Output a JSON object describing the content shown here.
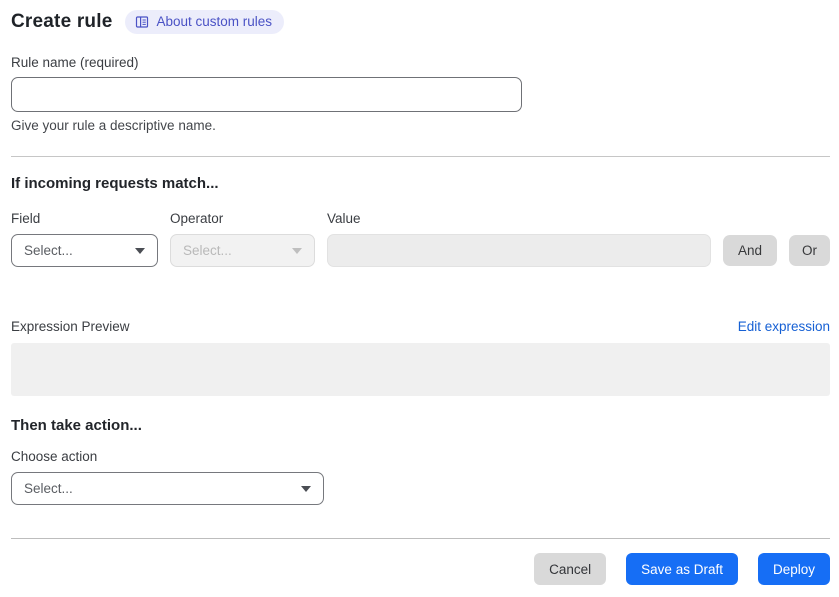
{
  "page": {
    "title": "Create rule",
    "badge_label": "About custom rules"
  },
  "rule_name": {
    "label": "Rule name (required)",
    "value": "",
    "helper": "Give your rule a descriptive name."
  },
  "match_section": {
    "heading": "If incoming requests match...",
    "field_label": "Field",
    "operator_label": "Operator",
    "value_label": "Value",
    "field_value": "Select...",
    "operator_value": "Select...",
    "value_value": "",
    "and_label": "And",
    "or_label": "Or"
  },
  "expression": {
    "label": "Expression Preview",
    "edit_link": "Edit expression",
    "content": ""
  },
  "action_section": {
    "heading": "Then take action...",
    "label": "Choose action",
    "value": "Select..."
  },
  "footer": {
    "cancel": "Cancel",
    "save_draft": "Save as Draft",
    "deploy": "Deploy"
  },
  "colors": {
    "button_blue": "#166ef5",
    "link_blue": "#1660d4",
    "badge_bg": "#ecedfb",
    "badge_text": "#4a52c5",
    "neutral_button_bg": "#d9d9d9",
    "disabled_bg": "#f2f2f2",
    "preview_bg": "#f0f0f0"
  }
}
